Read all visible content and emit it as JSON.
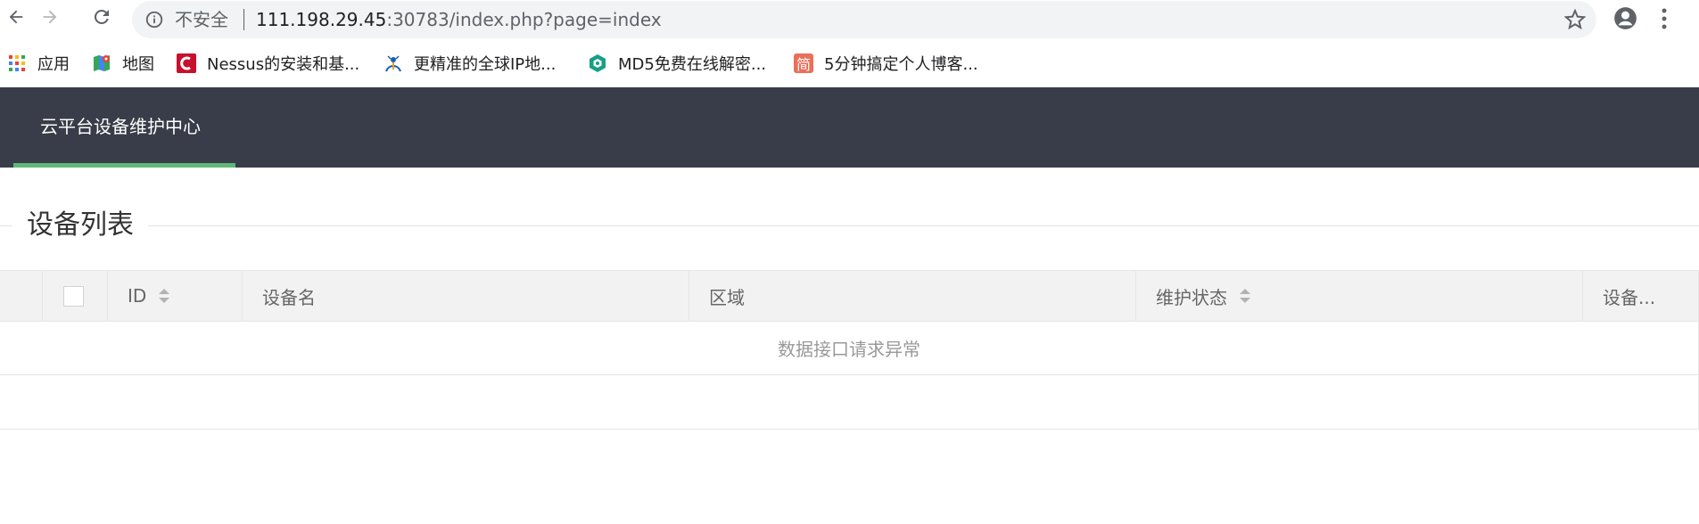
{
  "browser": {
    "url_security": "不安全",
    "url_host": "111.198.29.45",
    "url_rest": ":30783/index.php?page=index",
    "bookmarks": [
      {
        "label": "应用",
        "icon": "apps-grid-icon"
      },
      {
        "label": "地图",
        "icon": "maps-icon"
      },
      {
        "label": "Nessus的安装和基...",
        "icon": "nessus-icon"
      },
      {
        "label": "更精准的全球IP地...",
        "icon": "ip-location-icon"
      },
      {
        "label": "MD5免费在线解密...",
        "icon": "md5-icon"
      },
      {
        "label": "5分钟搞定个人博客...",
        "icon": "jianshu-icon"
      }
    ],
    "jianshu_glyph": "简"
  },
  "app": {
    "title": "云平台设备维护中心",
    "header_bg": "#393d49",
    "accent": "#5fb878"
  },
  "section": {
    "title": "设备列表"
  },
  "table": {
    "columns": [
      "ID",
      "设备名",
      "区域",
      "维护状态",
      "设备..."
    ],
    "empty_message": "数据接口请求异常"
  }
}
